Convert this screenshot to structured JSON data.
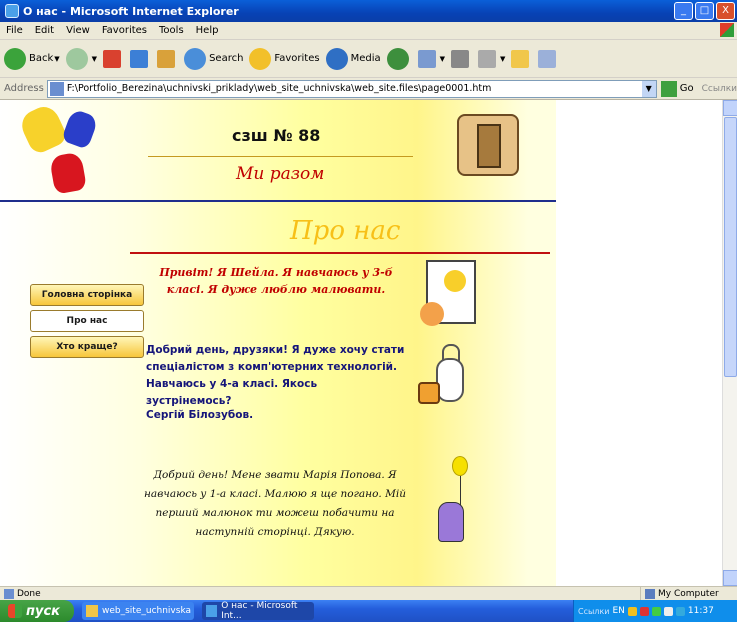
{
  "window": {
    "title": "О нас - Microsoft Internet Explorer",
    "minimize": "_",
    "maximize": "□",
    "close": "X"
  },
  "menu": [
    "File",
    "Edit",
    "View",
    "Favorites",
    "Tools",
    "Help"
  ],
  "toolbar": {
    "back": "Back",
    "search": "Search",
    "favorites": "Favorites",
    "media": "Media"
  },
  "address": {
    "label": "Address",
    "value": "F:\\Portfolio_Berezina\\uchnivski_priklady\\web_site_uchnivska\\web_site.files\\page0001.htm",
    "go": "Go",
    "links": "Ссылки"
  },
  "page": {
    "school_title": "сзш № 88",
    "motto": "Ми разом",
    "page_title": "Про нас",
    "nav": {
      "home": "Головна сторінка",
      "about": "Про нас",
      "best": "Хто краще?"
    },
    "msg1": "Привіт!  Я Шейла.   Я навчаюсь у 3-б класі.  Я дуже люблю малювати.",
    "msg2": "Добрий день, друзяки! Я дуже хочу стати спеціалістом з комп'ютерних технологій. Навчаюсь у 4-а класі. Якось зустрінемось?",
    "sign": "Сергій Білозубов.",
    "msg3": "Добрий день! Мене звати Марія Попова. Я навчаюсь у 1-а класі. Малюю я ще погано. Мій перший малюнок ти можеш побачити на наступній сторінці. Дякую."
  },
  "status": {
    "left": "Done",
    "zone": "My Computer"
  },
  "taskbar": {
    "start": "пуск",
    "task1": "web_site_uchnivska",
    "task2": "О нас - Microsoft Int...",
    "tray_links": "Ссылки",
    "lang": "EN",
    "clock": "11:37"
  }
}
